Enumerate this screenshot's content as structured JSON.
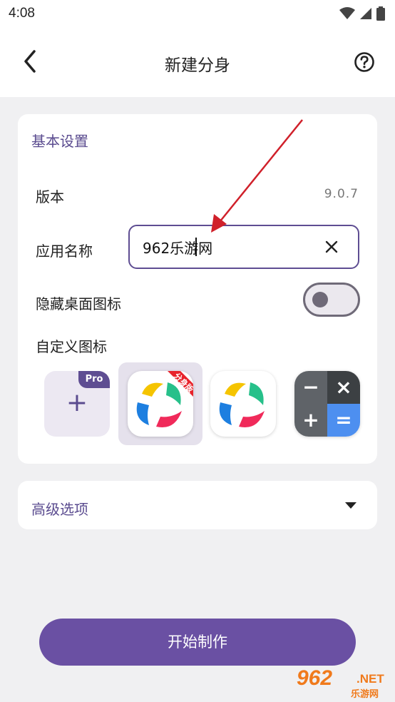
{
  "status_bar": {
    "time": "4:08",
    "icons": [
      "wifi-icon",
      "signal-icon",
      "battery-icon"
    ]
  },
  "app_bar": {
    "title": "新建分身",
    "back_icon": "chevron-left-icon",
    "help_icon": "help-circle-icon"
  },
  "basic_settings": {
    "section_title": "基本设置",
    "version_label": "版本",
    "version_value": "9.0.7",
    "app_name_label": "应用名称",
    "app_name_value": "962乐游网",
    "hide_icon_label": "隐藏桌面图标",
    "hide_icon_enabled": false,
    "custom_icon_label": "自定义图标",
    "icon_options": [
      {
        "name": "add-custom-icon",
        "badge": "Pro"
      },
      {
        "name": "app-icon-clone",
        "badge": "分身版",
        "selected": true
      },
      {
        "name": "app-icon-original",
        "selected": false
      },
      {
        "name": "calculator-icon",
        "selected": false
      }
    ]
  },
  "advanced": {
    "section_title": "高级选项",
    "expand_icon": "caret-down-icon"
  },
  "start_button_label": "开始制作",
  "watermark": {
    "number": "962",
    "suffix": ".NET",
    "cn_text": "乐游网"
  },
  "colors": {
    "accent": "#6a50a3",
    "accent_dark": "#5a4b8f",
    "annotation_arrow": "#d0202a",
    "watermark": "#f07a1c"
  }
}
